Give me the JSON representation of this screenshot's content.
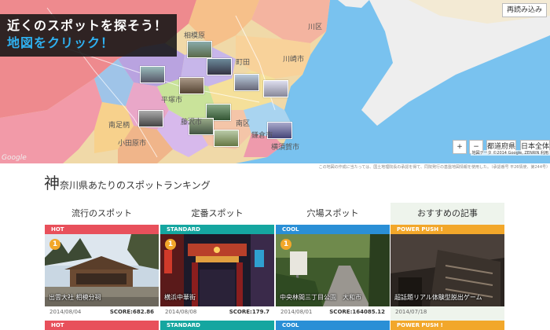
{
  "map": {
    "promo_line1": "近くのスポットを探そう！",
    "promo_line2": "地図をクリック！",
    "reload_button": "再読み込み",
    "zoom_in": "+",
    "zoom_out": "−",
    "prefecture_button": "都道府県",
    "japan_button": "日本全体",
    "attribution": "地図データ ©2014 Google, ZENRIN  利用",
    "google_logo": "Google",
    "labels": {
      "kawasaki": "川崎市",
      "sagamihara": "相模原",
      "machida": "町田",
      "hiratsuka": "平塚市",
      "odawara": "小田原市",
      "yokosuka": "横須賀市",
      "ku": "川区",
      "ebina": "南足柄",
      "fujisawa": "藤沢市",
      "kamakura": "鎌倉市",
      "minami": "南区"
    }
  },
  "notice": "この地図の作成に当たっては、国土地理院長の承認を得て、同院発行の基盤地図情報を使用した。（承認番号 平26情使、第244号）",
  "heading": {
    "big_char": "神",
    "rest": "奈川県あたりのスポットランキング"
  },
  "columns": [
    {
      "title": "流行のスポット",
      "tag": "HOT",
      "tag_color": "#e8505b",
      "rank": "1",
      "caption": "出雲大社 相模分祠",
      "date": "2014/08/04",
      "score": "SCORE:682.86",
      "next_tag": "HOT"
    },
    {
      "title": "定番スポット",
      "tag": "STANDARD",
      "tag_color": "#15a6a0",
      "rank": "1",
      "caption": "横浜中華街",
      "date": "2014/08/08",
      "score": "SCORE:179.7",
      "next_tag": "STANDARD"
    },
    {
      "title": "穴場スポット",
      "tag": "COOL",
      "tag_color": "#2a8fd6",
      "rank": "1",
      "caption": "中央林間三丁目公園　大和市",
      "date": "2014/08/01",
      "score": "SCORE:164085.12",
      "next_tag": "COOL"
    },
    {
      "title": "おすすめの記事",
      "tag": "POWER PUSH !",
      "tag_color": "#f2a72a",
      "caption": "超話題リアル体験型脱出ゲーム",
      "date": "2014/07/18",
      "next_tag": "POWER PUSH !"
    }
  ]
}
